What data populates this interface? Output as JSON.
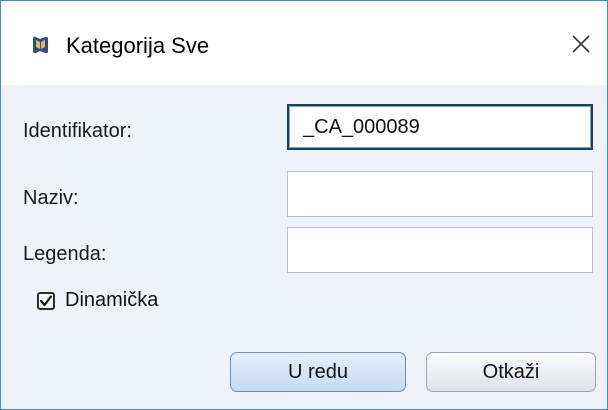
{
  "window": {
    "title": "Kategorija Sve",
    "icon": "app-logo-icon",
    "close_icon": "close-icon"
  },
  "form": {
    "identifier_label": "Identifikator:",
    "identifier_value": "_CA_000089",
    "name_label": "Naziv:",
    "name_value": "",
    "legend_label": "Legenda:",
    "legend_value": "",
    "dynamic_label": "Dinamička",
    "dynamic_checked": true
  },
  "buttons": {
    "ok_label": "U redu",
    "cancel_label": "Otkaži"
  },
  "colors": {
    "window_border": "#3f8fd8",
    "background": "#eef3fa",
    "focus_border": "#1e3c6a"
  }
}
